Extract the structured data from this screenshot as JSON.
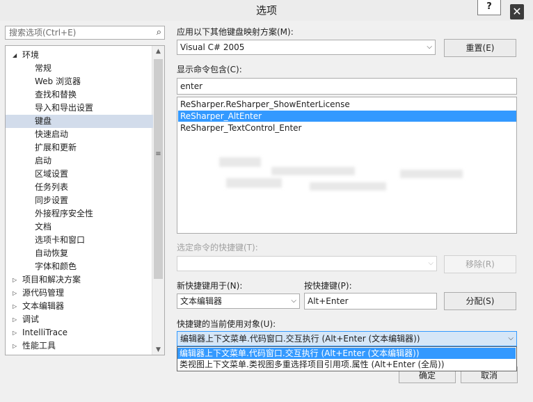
{
  "window": {
    "title": "选项",
    "help_label": "?",
    "close_label": "✕"
  },
  "search": {
    "placeholder": "搜索选项(Ctrl+E)",
    "icon": "search-icon"
  },
  "tree": {
    "items": [
      {
        "label": "环境",
        "level": 0,
        "expanded": true
      },
      {
        "label": "常规",
        "level": 1
      },
      {
        "label": "Web 浏览器",
        "level": 1
      },
      {
        "label": "查找和替换",
        "level": 1
      },
      {
        "label": "导入和导出设置",
        "level": 1
      },
      {
        "label": "键盘",
        "level": 1,
        "selected": true
      },
      {
        "label": "快速启动",
        "level": 1
      },
      {
        "label": "扩展和更新",
        "level": 1
      },
      {
        "label": "启动",
        "level": 1
      },
      {
        "label": "区域设置",
        "level": 1
      },
      {
        "label": "任务列表",
        "level": 1
      },
      {
        "label": "同步设置",
        "level": 1
      },
      {
        "label": "外接程序安全性",
        "level": 1
      },
      {
        "label": "文档",
        "level": 1
      },
      {
        "label": "选项卡和窗口",
        "level": 1
      },
      {
        "label": "自动恢复",
        "level": 1
      },
      {
        "label": "字体和颜色",
        "level": 1
      },
      {
        "label": "项目和解决方案",
        "level": 0,
        "expanded": false
      },
      {
        "label": "源代码管理",
        "level": 0,
        "expanded": false
      },
      {
        "label": "文本编辑器",
        "level": 0,
        "expanded": false
      },
      {
        "label": "调试",
        "level": 0,
        "expanded": false
      },
      {
        "label": "IntelliTrace",
        "level": 0,
        "expanded": false
      },
      {
        "label": "性能工具",
        "level": 0,
        "expanded": false
      }
    ]
  },
  "keyboard": {
    "mapping_label": "应用以下其他键盘映射方案(M):",
    "mapping_value": "Visual C# 2005",
    "reset_label": "重置(E)",
    "show_commands_label": "显示命令包含(C):",
    "filter_value": "enter",
    "commands": [
      {
        "label": "ReSharper.ReSharper_ShowEnterLicense",
        "selected": false
      },
      {
        "label": "ReSharper_AltEnter",
        "selected": true
      },
      {
        "label": "ReSharper_TextControl_Enter",
        "selected": false
      }
    ],
    "selected_shortcut_label": "选定命令的快捷键(T):",
    "selected_shortcut_value": "",
    "remove_label": "移除(R)",
    "use_in_label": "新快捷键用于(N):",
    "use_in_value": "文本编辑器",
    "press_keys_label": "按快捷键(P):",
    "press_keys_value": "Alt+Enter",
    "assign_label": "分配(S)",
    "currently_used_label": "快捷键的当前使用对象(U):",
    "currently_used_value": "编辑器上下文菜单.代码窗口.交互执行 (Alt+Enter (文本编辑器))",
    "currently_used_options": [
      {
        "label": "编辑器上下文菜单.代码窗口.交互执行 (Alt+Enter (文本编辑器))",
        "selected": true
      },
      {
        "label": "类视图上下文菜单.类视图多重选择项目引用项.属性 (Alt+Enter (全局))",
        "selected": false
      }
    ]
  },
  "footer": {
    "ok_label": "确定",
    "cancel_label": "取消"
  },
  "colors": {
    "accent": "#3399ff",
    "tree_selected": "#d2dceb",
    "title_bar": "#ececec",
    "dialog_bg": "#f0f0f0"
  }
}
